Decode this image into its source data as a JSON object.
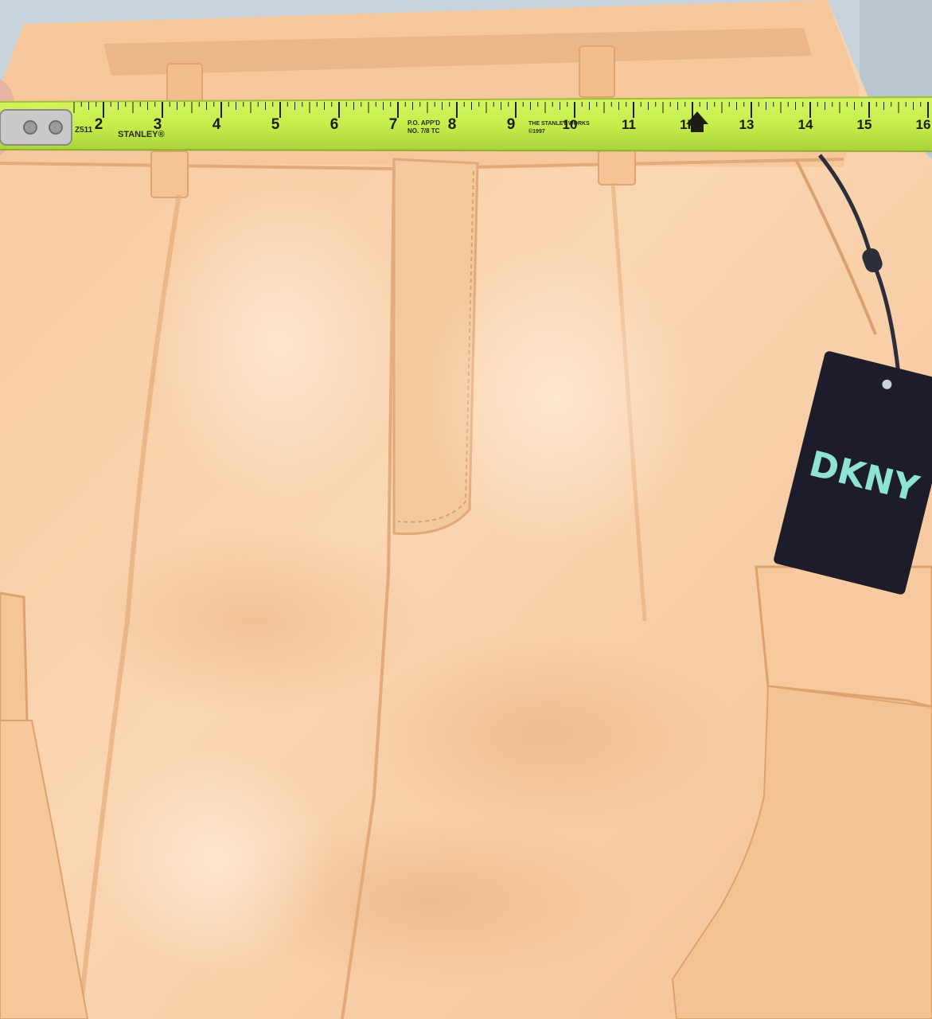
{
  "photo": {
    "colors": {
      "fabric": "#f7cfa7",
      "fabric_shadow": "#e8b487",
      "fabric_highlight": "#fbe0c3",
      "background": "#c9d3db",
      "tape": "#c6ee4c",
      "tape_edge": "#9fc035",
      "tag": "#1d1c2a",
      "tag_logo": "#8fe3d6"
    },
    "tape": {
      "numbers": [
        "2",
        "3",
        "4",
        "5",
        "6",
        "7",
        "8",
        "9",
        "10",
        "11",
        "1F",
        "13",
        "14",
        "15",
        "16"
      ],
      "brand": "STANLEY®",
      "code": "Z511",
      "small_text_1": "P.O. APP'D",
      "small_text_2": "NO. 7/8 TC",
      "small_text_3": "THE STANLEY WORKS",
      "small_text_4": "©1997"
    },
    "tag": {
      "logo": "DKNY"
    }
  }
}
